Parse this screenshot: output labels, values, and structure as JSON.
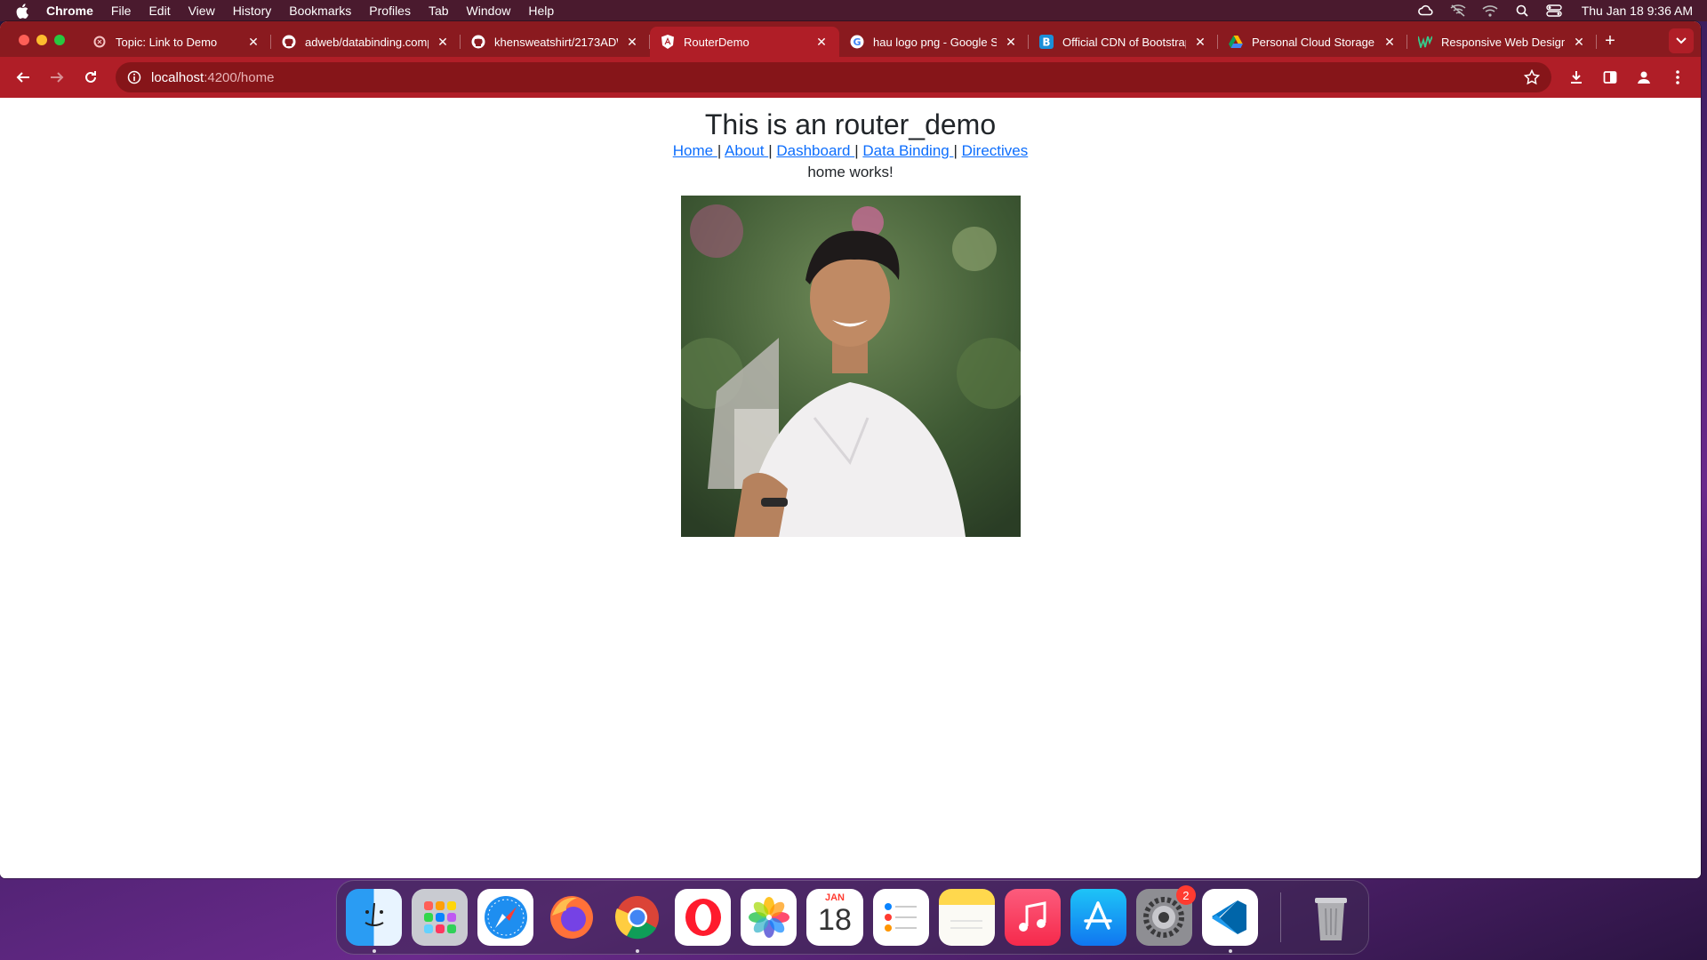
{
  "menubar": {
    "app_name": "Chrome",
    "items": [
      "File",
      "Edit",
      "View",
      "History",
      "Bookmarks",
      "Profiles",
      "Tab",
      "Window",
      "Help"
    ],
    "clock": "Thu Jan 18  9:36 AM"
  },
  "browser": {
    "tabs": [
      {
        "title": "Topic: Link to Demo",
        "icon": "discourse-icon"
      },
      {
        "title": "adweb/databinding.comp",
        "icon": "github-icon"
      },
      {
        "title": "khensweatshirt/2173ADW",
        "icon": "github-icon"
      },
      {
        "title": "RouterDemo",
        "icon": "angular-icon"
      },
      {
        "title": "hau logo png - Google Se",
        "icon": "google-icon"
      },
      {
        "title": "Official CDN of Bootstrap",
        "icon": "bootstrap-icon"
      },
      {
        "title": "Personal Cloud Storage &",
        "icon": "google-drive-icon"
      },
      {
        "title": "Responsive Web Design |",
        "icon": "w3-icon"
      }
    ],
    "active_tab_index": 3,
    "address": {
      "host": "localhost",
      "path": ":4200/home"
    }
  },
  "page": {
    "heading": "This is an router_demo",
    "nav": [
      {
        "label": "Home "
      },
      {
        "label": "About "
      },
      {
        "label": "Dashboard "
      },
      {
        "label": "Data Binding "
      },
      {
        "label": "Directives"
      }
    ],
    "separator": "|",
    "status": "home works!"
  },
  "dock": {
    "apps": [
      "finder-icon",
      "launchpad-icon",
      "safari-icon",
      "firefox-icon",
      "chrome-icon",
      "opera-icon",
      "photos-icon",
      "calendar-icon",
      "reminders-icon",
      "notes-icon",
      "music-icon",
      "app-store-icon",
      "system-settings-icon",
      "vscode-icon",
      "trash-icon"
    ],
    "calendar": {
      "month": "JAN",
      "day": "18"
    },
    "settings_badge": "2"
  },
  "colors": {
    "chrome_frame": "#8a1a1f",
    "chrome_toolbar": "#b01e27",
    "link": "#0d6efd"
  }
}
